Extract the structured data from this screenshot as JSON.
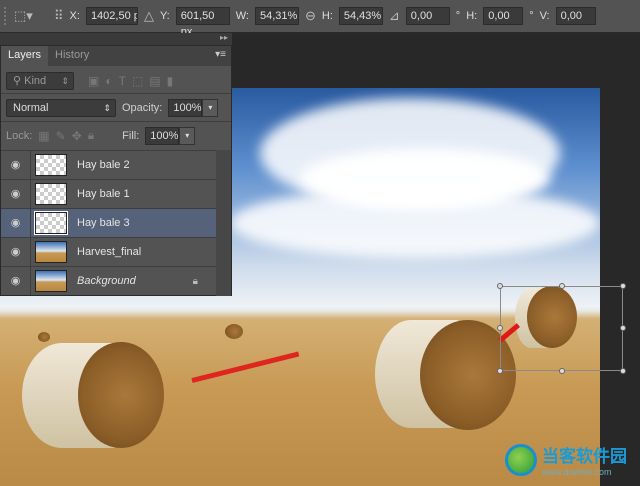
{
  "options_bar": {
    "x_label": "X:",
    "x_value": "1402,50 p",
    "y_label": "Y:",
    "y_value": "601,50 px",
    "w_label": "W:",
    "w_value": "54,31%",
    "h_label": "H:",
    "h_value": "54,43%",
    "angle_value": "0,00",
    "degree": "°",
    "hskew_label": "H:",
    "hskew_value": "0,00",
    "vskew_label": "V:",
    "vskew_value": "0,00"
  },
  "panel": {
    "collapse": "▸▸",
    "tabs": [
      "Layers",
      "History"
    ],
    "filter_kind": "Kind",
    "blend_mode": "Normal",
    "opacity_label": "Opacity:",
    "opacity_value": "100%",
    "lock_label": "Lock:",
    "fill_label": "Fill:",
    "fill_value": "100%",
    "layers": [
      {
        "name": "Hay bale 2"
      },
      {
        "name": "Hay bale 1"
      },
      {
        "name": "Hay bale 3",
        "selected": true
      },
      {
        "name": "Harvest_final"
      },
      {
        "name": "Background",
        "locked": true
      }
    ]
  },
  "watermark": {
    "title": "当客软件园",
    "url": "www.downkr.com"
  }
}
